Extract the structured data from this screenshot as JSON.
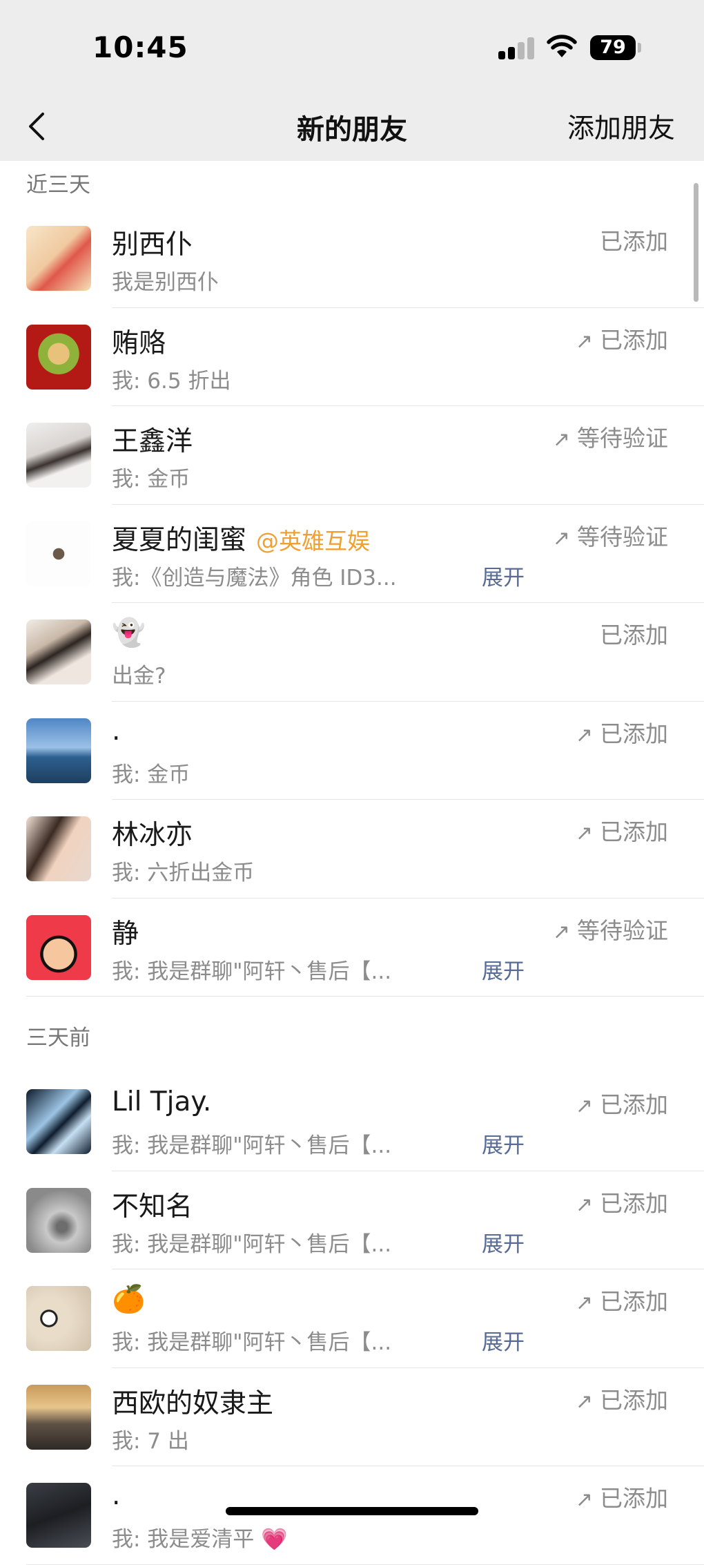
{
  "status_bar": {
    "time": "10:45",
    "battery": "79"
  },
  "nav": {
    "title": "新的朋友",
    "action": "添加朋友"
  },
  "sections": [
    {
      "label": "近三天",
      "items": [
        {
          "name": "别西仆",
          "tag": "",
          "message": "我是别西仆",
          "expand": "",
          "arrow": "",
          "status": "已添加",
          "avatar_bg": "linear-gradient(135deg,#f7e6c8,#f0c9a0 45%,#e0584a 60%,#f5e2b8)"
        },
        {
          "name": "贿赂",
          "tag": "",
          "message": "我: 6.5 折出",
          "expand": "",
          "arrow": "↗",
          "status": "已添加",
          "avatar_bg": "radial-gradient(circle at 50% 45%,#e8c27a 0 22%,#8fb33a 23% 42%,#b31a16 43%)"
        },
        {
          "name": "王鑫洋",
          "tag": "",
          "message": "我: 金币",
          "expand": "",
          "arrow": "↗",
          "status": "等待验证",
          "avatar_bg": "linear-gradient(160deg,#efefef,#d9d4d0 40%,#3a3330 55%,#f3f1ef 70%)"
        },
        {
          "name": "夏夏的闺蜜",
          "tag": "@英雄互娱",
          "message": "我:《创造与魔法》角色 ID3...",
          "expand": "展开",
          "arrow": "↗",
          "status": "等待验证",
          "avatar_bg": "radial-gradient(circle at 50% 50%,#6b5a4a 0 12%,#fdfdfd 13%)"
        },
        {
          "name": "👻",
          "tag": "",
          "message": "出金?",
          "expand": "",
          "arrow": "",
          "status": "已添加",
          "avatar_bg": "linear-gradient(150deg,#f1ece6,#c9b8a8 35%,#2d2521 50%,#efe7df 70%)"
        },
        {
          "name": ".",
          "tag": "",
          "message": "我: 金币",
          "expand": "",
          "arrow": "↗",
          "status": "已添加",
          "avatar_bg": "linear-gradient(180deg,#4f86c6,#9cc1e6 45%,#2c5f8f 60%,#1f3f5e)"
        },
        {
          "name": "林冰亦",
          "tag": "",
          "message": "我: 六折出金币",
          "expand": "",
          "arrow": "↗",
          "status": "已添加",
          "avatar_bg": "linear-gradient(120deg,#f4e3d6,#3b2a22 35%,#f1d3bf 55%,#e7d8cf)"
        },
        {
          "name": "静",
          "tag": "",
          "message": "我: 我是群聊\"阿轩丶售后【...",
          "expand": "展开",
          "arrow": "↗",
          "status": "等待验证",
          "avatar_bg": "radial-gradient(circle at 50% 60%,#f6c79e 0 30%,#111 31% 36%,#ef3a4a 37%)"
        }
      ]
    },
    {
      "label": "三天前",
      "items": [
        {
          "name": "Lil Tjay.",
          "tag": "",
          "message": "我: 我是群聊\"阿轩丶售后【...",
          "expand": "展开",
          "arrow": "↗",
          "status": "已添加",
          "avatar_bg": "linear-gradient(135deg,#0e1a2a,#9cc4e4 40%,#0f1d2e 55%,#c6dff2 70%,#101d2c)"
        },
        {
          "name": "不知名",
          "tag": "",
          "message": "我: 我是群聊\"阿轩丶售后【...",
          "expand": "展开",
          "arrow": "↗",
          "status": "已添加",
          "avatar_bg": "radial-gradient(circle at 55% 60%,#6d6d6d 0 10%,#c9c9c9 30%,#8a8a8a 70%)"
        },
        {
          "name": "🍊",
          "tag": "",
          "message": "我: 我是群聊\"阿轩丶售后【...",
          "expand": "展开",
          "arrow": "↗",
          "status": "已添加",
          "avatar_bg": "radial-gradient(circle at 35% 50%,#fff 0 12%,#222 13% 16%,#e9dcc9 17% 40%,#cfc1ab)"
        },
        {
          "name": "西欧的奴隶主",
          "tag": "",
          "message": "我: 7 出",
          "expand": "",
          "arrow": "↗",
          "status": "已添加",
          "avatar_bg": "linear-gradient(180deg,#c89a5b,#e7c58a 35%,#5f5246 60%,#2e2a26)"
        },
        {
          "name": ".",
          "tag": "",
          "message": "我: 我是爱清平 💗",
          "expand": "",
          "arrow": "↗",
          "status": "已添加",
          "avatar_bg": "linear-gradient(160deg,#3b3f45,#1c1e22 50%,#4a4e55)"
        }
      ]
    }
  ]
}
